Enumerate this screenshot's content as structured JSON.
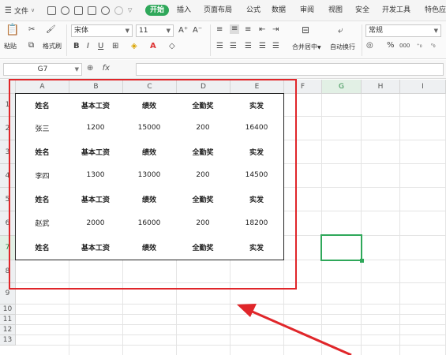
{
  "menu": {
    "file_label": "文件",
    "file_dropdown": "∨",
    "tabs": [
      "开始",
      "插入",
      "页面布局",
      "公式",
      "数据",
      "审阅",
      "视图",
      "安全",
      "开发工具",
      "特色应"
    ],
    "active_tab_index": 0
  },
  "ribbon": {
    "paste_label": "粘贴",
    "format_painter_label": "格式刷",
    "font_name": "宋体",
    "font_size": "11",
    "merge_center_label": "合并居中",
    "wrap_text_label": "自动换行",
    "number_format": "常规",
    "percent_symbol": "%",
    "thousands_symbol": "000",
    "increase_font": "A⁺",
    "decrease_font": "A⁻"
  },
  "formula_bar": {
    "name_box": "G7",
    "fx_label": "fx",
    "formula": ""
  },
  "columns": [
    "A",
    "B",
    "C",
    "D",
    "E",
    "F",
    "G",
    "H",
    "I"
  ],
  "rows": [
    "1",
    "2",
    "3",
    "4",
    "5",
    "6",
    "7",
    "8",
    "9",
    "10",
    "11",
    "12",
    "13"
  ],
  "selected_cell": "G7",
  "table": [
    [
      "姓名",
      "基本工资",
      "绩效",
      "全勤奖",
      "实发"
    ],
    [
      "张三",
      "1200",
      "15000",
      "200",
      "16400"
    ],
    [
      "姓名",
      "基本工资",
      "绩效",
      "全勤奖",
      "实发"
    ],
    [
      "李四",
      "1300",
      "13000",
      "200",
      "14500"
    ],
    [
      "姓名",
      "基本工资",
      "绩效",
      "全勤奖",
      "实发"
    ],
    [
      "赵武",
      "2000",
      "16000",
      "200",
      "18200"
    ],
    [
      "姓名",
      "基本工资",
      "绩效",
      "全勤奖",
      "实发"
    ]
  ],
  "header_rows": [
    0,
    2,
    4,
    6
  ],
  "colors": {
    "accent": "#2fa85a",
    "annotation_red": "#e0262a"
  }
}
